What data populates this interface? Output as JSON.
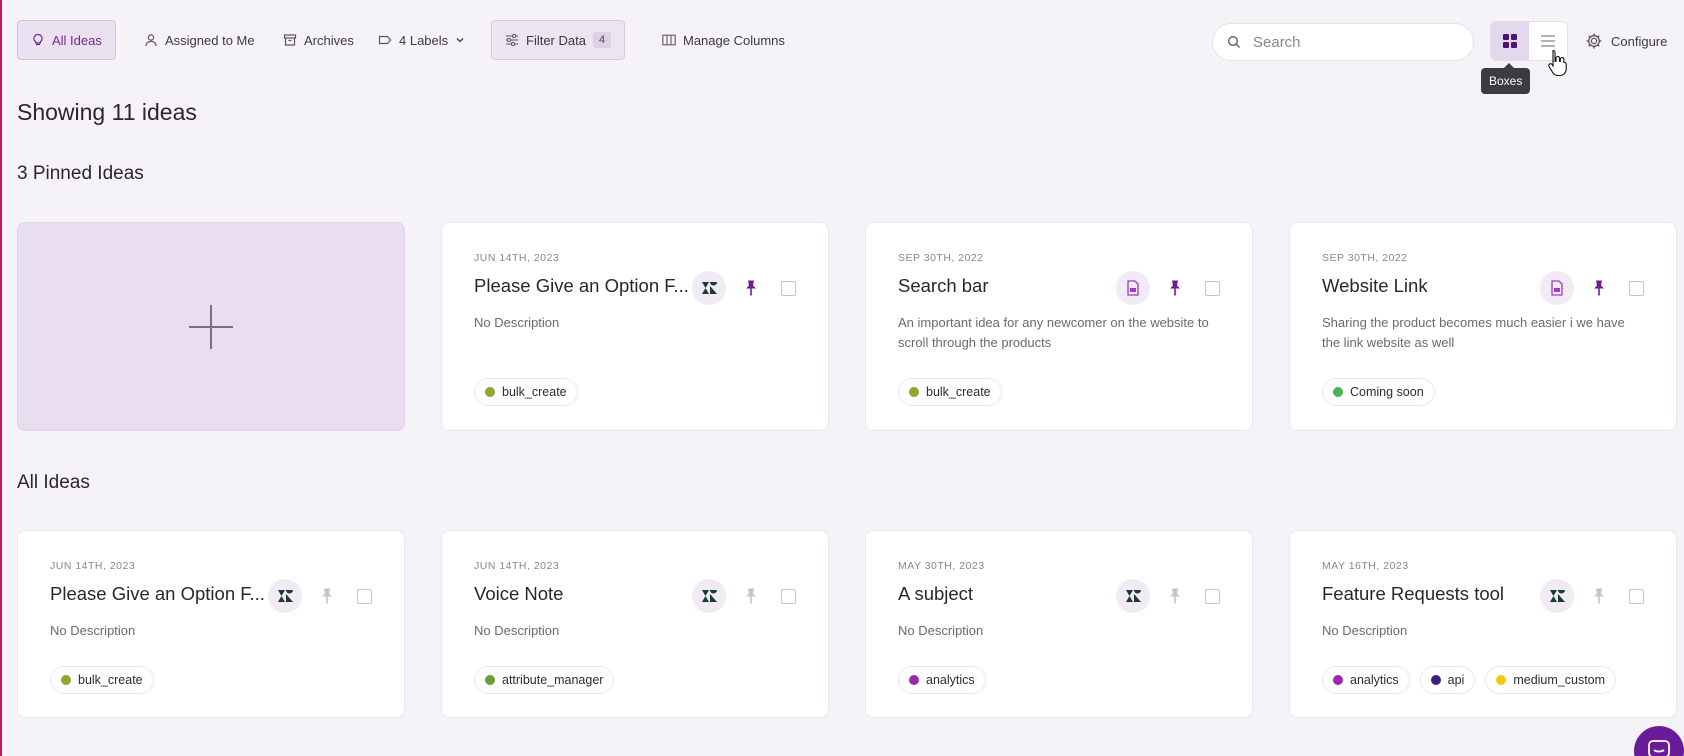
{
  "toolbar": {
    "all_ideas": "All Ideas",
    "assigned": "Assigned to Me",
    "archives": "Archives",
    "labels": "4 Labels",
    "filter": "Filter Data",
    "filter_count": "4",
    "manage_columns": "Manage Columns",
    "search_placeholder": "Search",
    "tooltip": "Boxes",
    "configure": "Configure"
  },
  "summary": "Showing 11 ideas",
  "pinned_heading": "3 Pinned Ideas",
  "all_heading": "All Ideas",
  "pinned": [
    {
      "date": "JUN 14TH, 2023",
      "title": "Please Give an Option F...",
      "desc": "No Description",
      "source": "zendesk-icon",
      "labels": [
        {
          "name": "bulk_create",
          "color": "#8fa52e"
        }
      ]
    },
    {
      "date": "SEP 30TH, 2022",
      "title": "Search bar",
      "desc": "An important idea for any newcomer on the website to scroll through the products",
      "source": "form-icon",
      "labels": [
        {
          "name": "bulk_create",
          "color": "#8fa52e"
        }
      ]
    },
    {
      "date": "SEP 30TH, 2022",
      "title": "Website Link",
      "desc": "Sharing the product becomes much easier i we have the link website as well",
      "source": "form-icon",
      "labels": [
        {
          "name": "Coming soon",
          "color": "#4caf50"
        }
      ]
    }
  ],
  "ideas": [
    {
      "date": "JUN 14TH, 2023",
      "title": "Please Give an Option F...",
      "desc": "No Description",
      "source": "zendesk-icon",
      "labels": [
        {
          "name": "bulk_create",
          "color": "#8fa52e"
        }
      ]
    },
    {
      "date": "JUN 14TH, 2023",
      "title": "Voice Note",
      "desc": "No Description",
      "source": "zendesk-icon",
      "labels": [
        {
          "name": "attribute_manager",
          "color": "#6e9a3a"
        }
      ]
    },
    {
      "date": "MAY 30TH, 2023",
      "title": "A subject",
      "desc": "No Description",
      "source": "zendesk-icon",
      "labels": [
        {
          "name": "analytics",
          "color": "#9c27b0"
        }
      ]
    },
    {
      "date": "MAY 16TH, 2023",
      "title": "Feature Requests tool",
      "desc": "No Description",
      "source": "zendesk-icon",
      "labels": [
        {
          "name": "analytics",
          "color": "#9c27b0"
        },
        {
          "name": "api",
          "color": "#3f1d7a"
        },
        {
          "name": "medium_custom",
          "color": "#f2c811"
        }
      ]
    }
  ],
  "colors": {
    "accent": "#6b1d8f",
    "pin_active": "#6b1d8f",
    "pin_inactive": "#c9c2cd"
  }
}
